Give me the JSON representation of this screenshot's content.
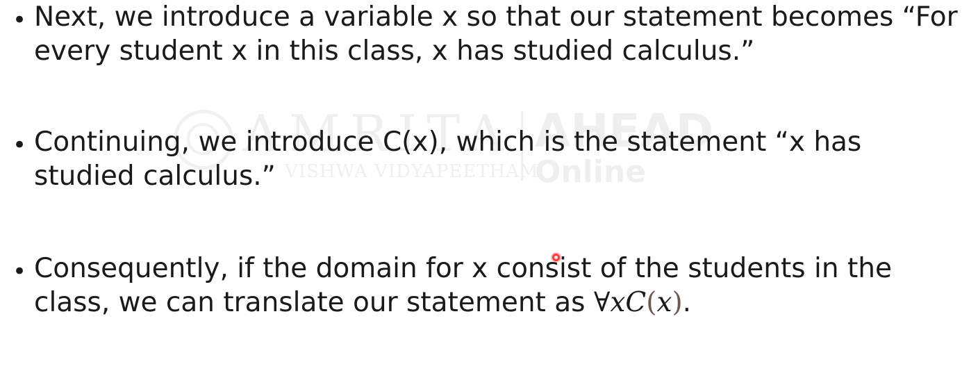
{
  "watermark": {
    "brand": "AMRITA",
    "subtitle": "VISHWA VIDYAPEETHAM",
    "ahead": "AHEAD",
    "online": "Online"
  },
  "bullets": [
    {
      "marker": "•",
      "text": "Next, we introduce a variable x so that our statement becomes “For every student x in this class, x has studied calculus.”"
    },
    {
      "marker": "•",
      "text": "Continuing, we introduce C(x), which is the statement “x has studied calculus.”"
    },
    {
      "marker": "•",
      "text_before_math": "Consequently, if the domain for x consist of the students in the class, we can translate our statement as ",
      "math": {
        "quantifier": "∀",
        "var1": "x",
        "predicate": "C",
        "open_paren": "(",
        "var2": "x",
        "close_paren": ")"
      },
      "text_after_math": "."
    }
  ],
  "colors": {
    "text": "#1a1a1a",
    "background": "#ffffff",
    "pointer": "#ff3b3b"
  }
}
